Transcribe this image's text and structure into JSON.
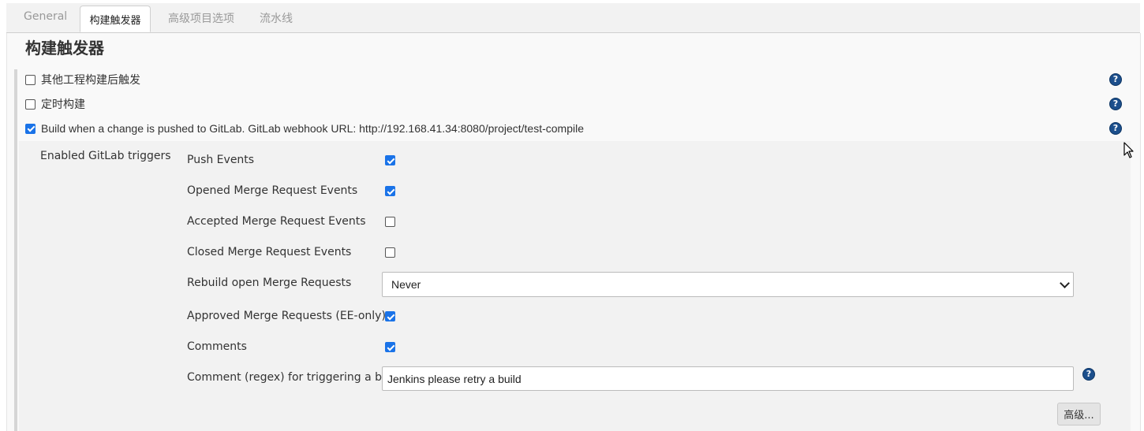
{
  "tabs": [
    {
      "label": "General",
      "active": false
    },
    {
      "label": "构建触发器",
      "active": true
    },
    {
      "label": "高级项目选项",
      "active": false
    },
    {
      "label": "流水线",
      "active": false
    }
  ],
  "section": {
    "title": "构建触发器"
  },
  "triggers": [
    {
      "label": "其他工程构建后触发",
      "checked": false
    },
    {
      "label": "定时构建",
      "checked": false
    },
    {
      "label": "Build when a change is pushed to GitLab. GitLab webhook URL: http://192.168.41.34:8080/project/test-compile",
      "checked": true
    }
  ],
  "gitlab": {
    "title": "Enabled GitLab triggers",
    "options": [
      {
        "label": "Push Events",
        "checked": true
      },
      {
        "label": "Opened Merge Request Events",
        "checked": true
      },
      {
        "label": "Accepted Merge Request Events",
        "checked": false
      },
      {
        "label": "Closed Merge Request Events",
        "checked": false
      },
      {
        "label": "Rebuild open Merge Requests",
        "type": "select"
      },
      {
        "label": "Approved Merge Requests (EE-only)",
        "checked": true
      },
      {
        "label": "Comments",
        "checked": true
      },
      {
        "label": "Comment (regex) for triggering a build",
        "type": "text"
      }
    ],
    "rebuild_value": "Never",
    "comment_regex": "Jenkins please retry a build",
    "advanced_button": "高级..."
  },
  "icons": {
    "help": "help-icon",
    "cursor": "mouse-cursor-icon"
  },
  "colors": {
    "checkbox": "#1a73e8",
    "help": "#1c4f8c"
  }
}
